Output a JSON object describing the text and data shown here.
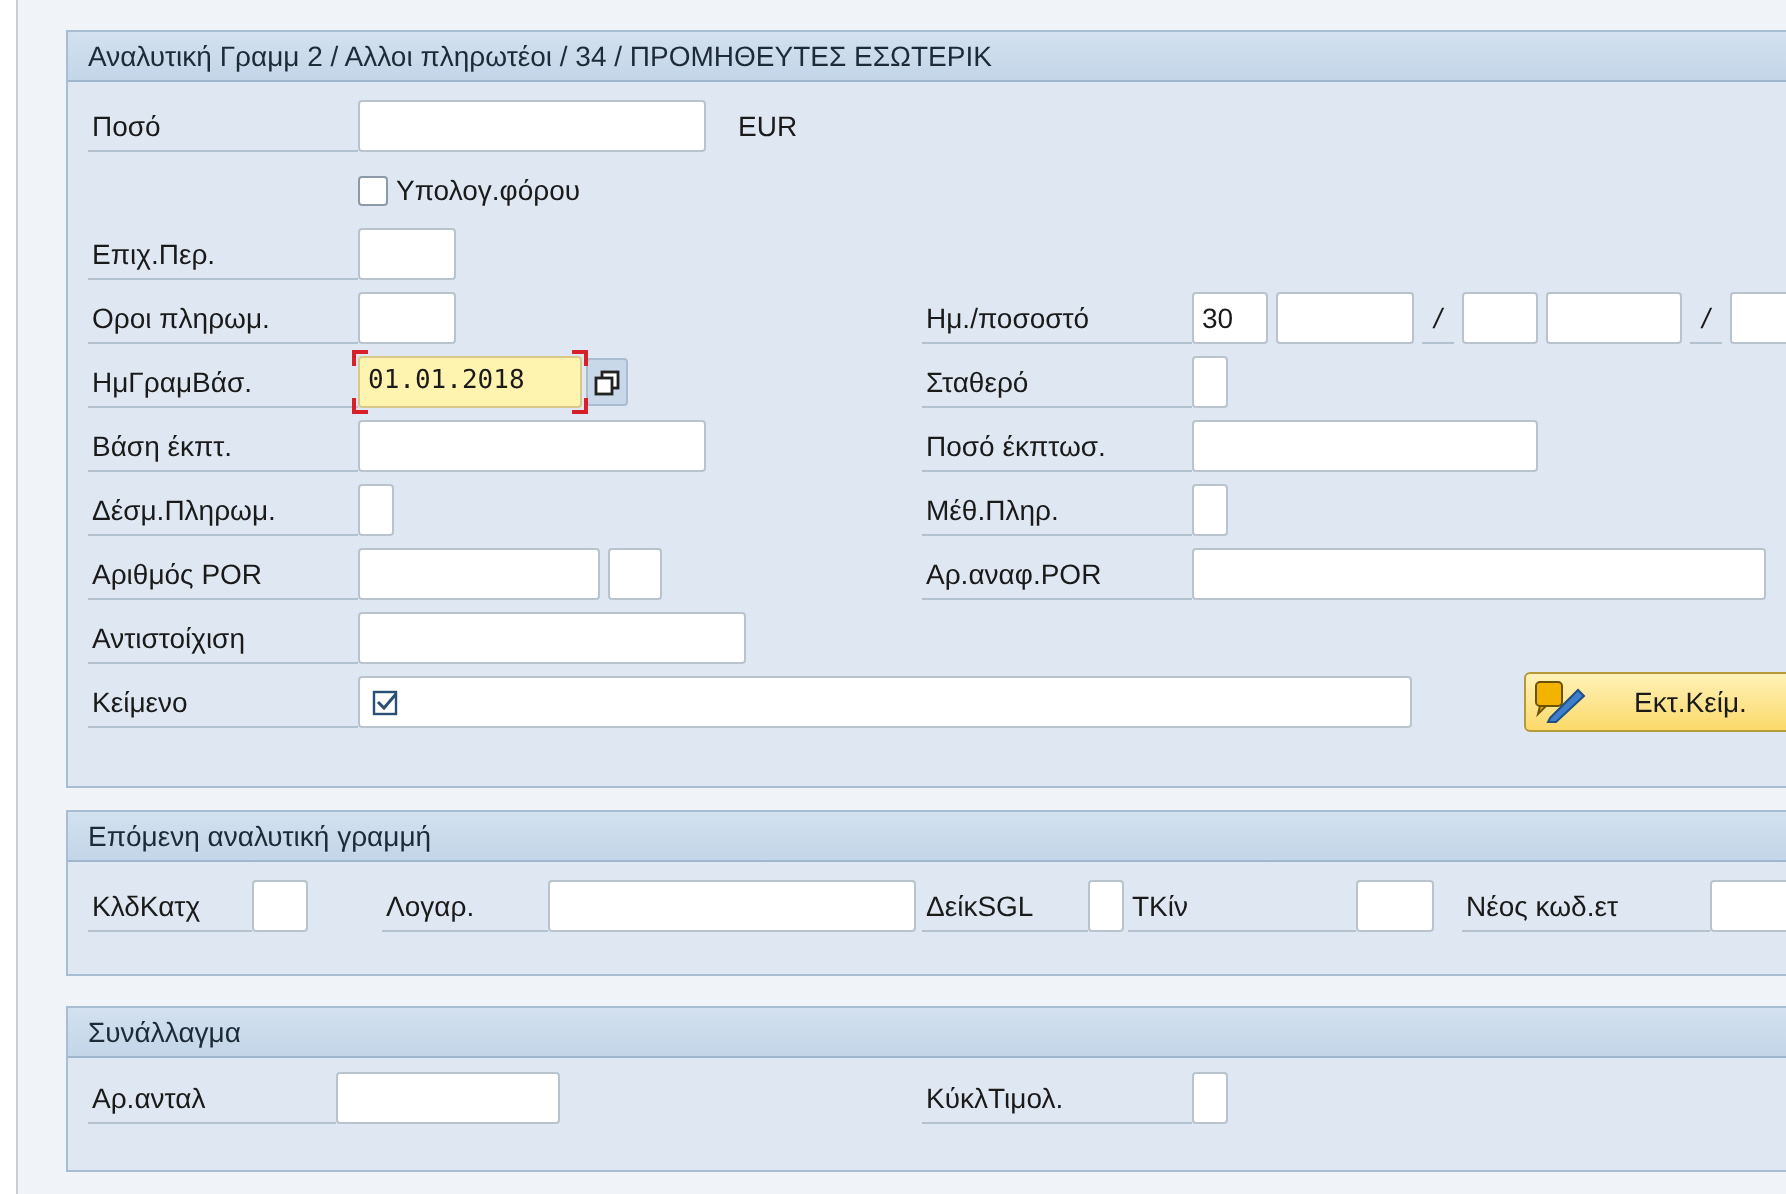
{
  "sections": [
    {
      "title": "Αναλυτική Γραμμ 2 / Αλλοι πληρωτέοι / 34 / ΠΡΟΜΗΘΕΥΤΕΣ ΕΣΩΤΕΡΙΚ",
      "rows": [
        {
          "items": [
            {
              "kind": "field",
              "label": "Ποσό",
              "fields": [
                {
                  "kind": "input"
                }
              ],
              "unit": "EUR"
            }
          ]
        },
        {
          "items": [
            {
              "kind": "checkbox",
              "label": "Υπολογ.φόρου",
              "checked": false
            }
          ]
        },
        {
          "items": [
            {
              "kind": "field",
              "label": "Επιχ.Περ.",
              "fields": [
                {
                  "kind": "input"
                }
              ]
            }
          ]
        },
        {
          "items": [
            {
              "kind": "field",
              "label": "Οροι πληρωμ.",
              "fields": [
                {
                  "kind": "input"
                }
              ]
            },
            {
              "kind": "field",
              "label": "Ημ./ποσοστό",
              "fields": [
                {
                  "kind": "input",
                  "value": "30"
                },
                {
                  "kind": "input"
                },
                {
                  "kind": "separator",
                  "text": "/"
                },
                {
                  "kind": "input"
                },
                {
                  "kind": "input"
                },
                {
                  "kind": "separator",
                  "text": "/"
                },
                {
                  "kind": "input"
                }
              ]
            }
          ]
        },
        {
          "items": [
            {
              "kind": "field",
              "label": "ΗμΓραμΒάσ.",
              "fields": [
                {
                  "kind": "date",
                  "value": "01.01.2018",
                  "focused": true
                }
              ]
            },
            {
              "kind": "field",
              "label": "Σταθερό",
              "fields": [
                {
                  "kind": "input"
                }
              ]
            }
          ]
        },
        {
          "items": [
            {
              "kind": "field",
              "label": "Βάση έκπτ.",
              "fields": [
                {
                  "kind": "input"
                }
              ]
            },
            {
              "kind": "field",
              "label": "Ποσό έκπτωσ.",
              "fields": [
                {
                  "kind": "input"
                }
              ]
            }
          ]
        },
        {
          "items": [
            {
              "kind": "field",
              "label": "Δέσμ.Πληρωμ.",
              "fields": [
                {
                  "kind": "input"
                }
              ]
            },
            {
              "kind": "field",
              "label": "Μέθ.Πληρ.",
              "fields": [
                {
                  "kind": "input"
                }
              ]
            }
          ]
        },
        {
          "items": [
            {
              "kind": "field",
              "label": "Αριθμός POR",
              "fields": [
                {
                  "kind": "input"
                },
                {
                  "kind": "input"
                }
              ]
            },
            {
              "kind": "field",
              "label": "Αρ.αναφ.POR",
              "fields": [
                {
                  "kind": "input"
                }
              ]
            }
          ]
        },
        {
          "items": [
            {
              "kind": "field",
              "label": "Αντιστοίχιση",
              "fields": [
                {
                  "kind": "input"
                }
              ]
            }
          ]
        },
        {
          "items": [
            {
              "kind": "field",
              "label": "Κείμενο",
              "fields": [
                {
                  "kind": "note",
                  "checked": true
                }
              ]
            },
            {
              "kind": "button",
              "label": "Εκτ.Κείμ."
            }
          ]
        }
      ]
    },
    {
      "title": "Επόμενη αναλυτική γραμμή",
      "rows": [
        {
          "items": [
            {
              "kind": "field",
              "label": "ΚλδΚατχ",
              "fields": [
                {
                  "kind": "input"
                }
              ]
            },
            {
              "kind": "field",
              "label": "Λογαρ.",
              "fields": [
                {
                  "kind": "input"
                }
              ]
            },
            {
              "kind": "field",
              "label": "ΔείκSGL",
              "fields": [
                {
                  "kind": "input"
                }
              ]
            },
            {
              "kind": "field",
              "label": "ΤΚίν",
              "fields": [
                {
                  "kind": "input"
                }
              ]
            },
            {
              "kind": "field",
              "label": "Νέος κωδ.ετ",
              "fields": [
                {
                  "kind": "input"
                }
              ]
            }
          ]
        }
      ]
    },
    {
      "title": "Συνάλλαγμα",
      "rows": [
        {
          "items": [
            {
              "kind": "field",
              "label": "Αρ.ανταλ",
              "fields": [
                {
                  "kind": "input"
                }
              ]
            },
            {
              "kind": "field",
              "label": "ΚύκλΤιμολ.",
              "fields": [
                {
                  "kind": "input"
                }
              ]
            }
          ]
        }
      ]
    }
  ]
}
